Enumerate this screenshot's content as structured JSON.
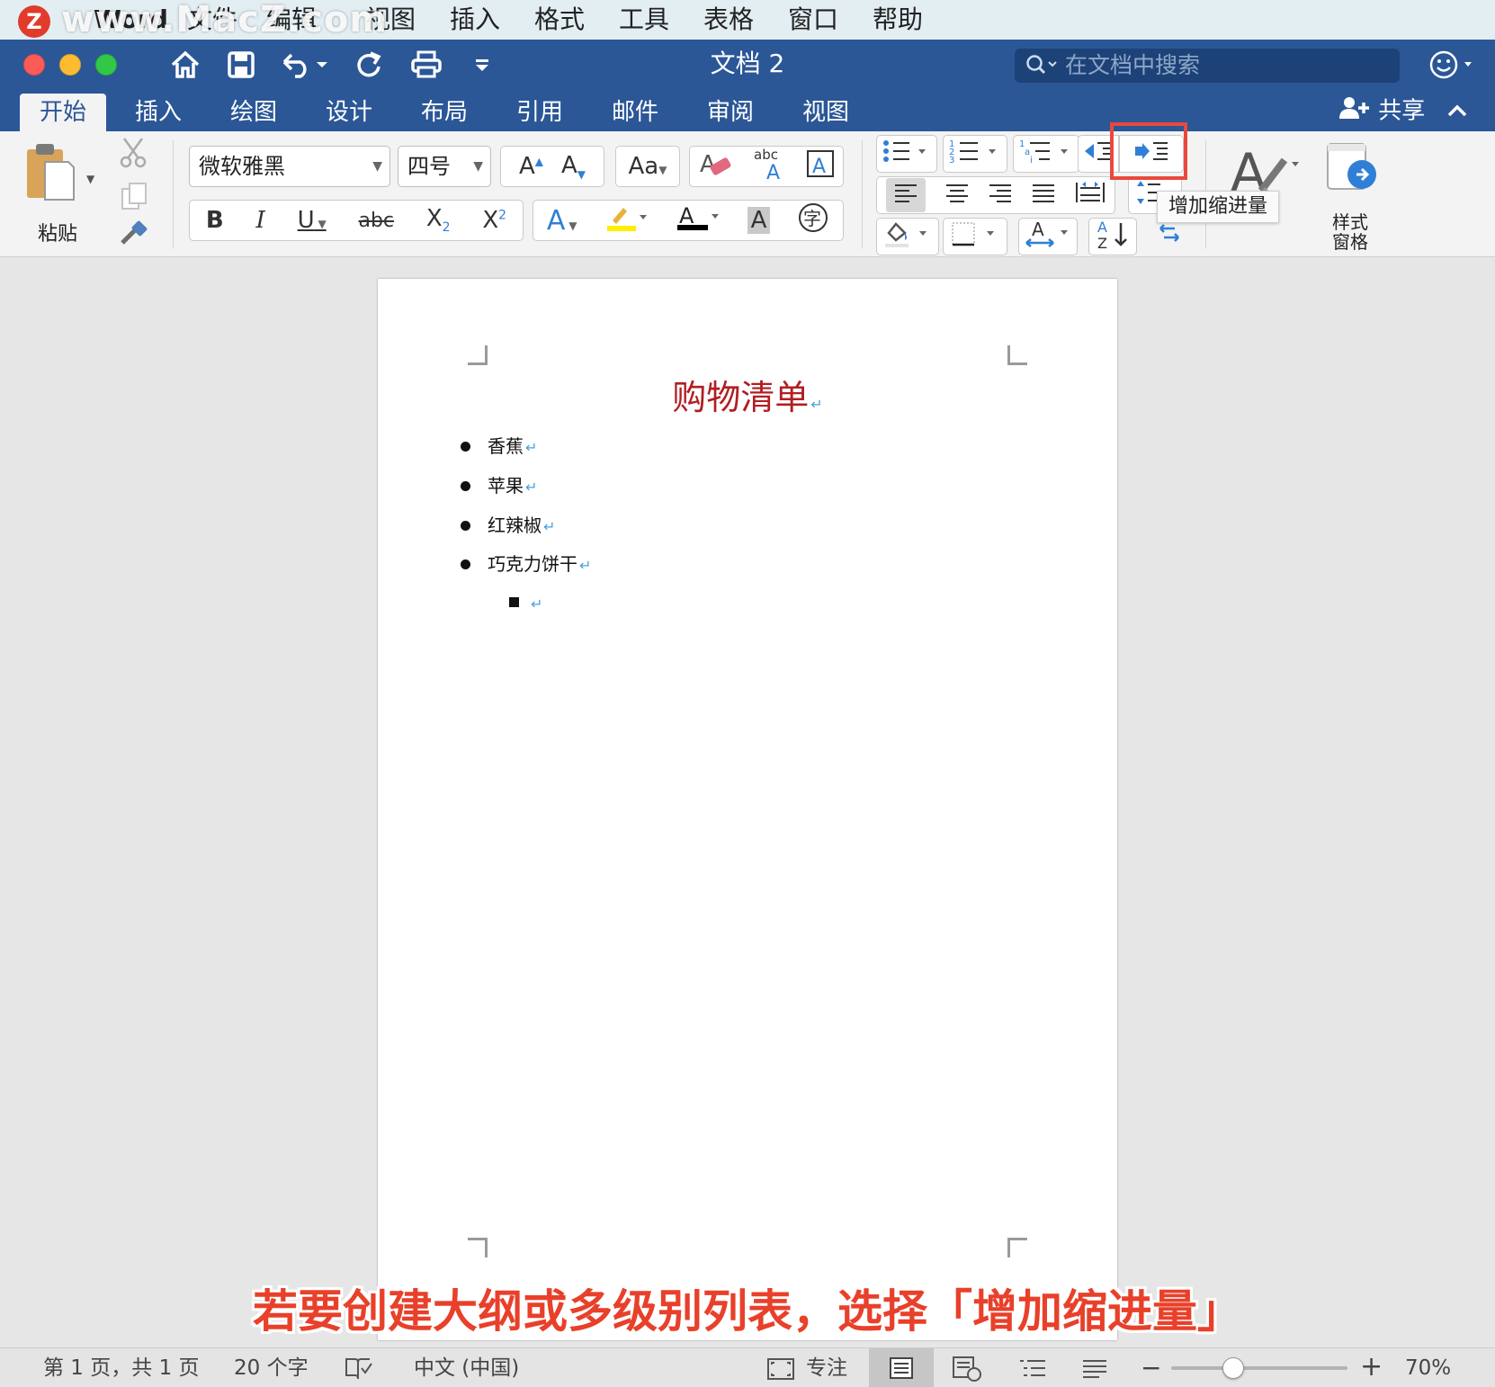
{
  "watermark": "www.MacZ.com",
  "menubar": {
    "app_name": "Word",
    "items": [
      "文件",
      "编辑",
      "视图",
      "插入",
      "格式",
      "工具",
      "表格",
      "窗口",
      "帮助"
    ]
  },
  "titlebar": {
    "title": "文档 2",
    "search_placeholder": "在文档中搜索"
  },
  "ribbon_tabs": {
    "tabs": [
      "开始",
      "插入",
      "绘图",
      "设计",
      "布局",
      "引用",
      "邮件",
      "审阅",
      "视图"
    ],
    "active": "开始",
    "share_label": "共享"
  },
  "ribbon": {
    "paste_label": "粘贴",
    "font_name": "微软雅黑",
    "font_size": "四号",
    "styles_pane_label": "样式窗格",
    "tooltip": "增加缩进量"
  },
  "document": {
    "heading": "购物清单",
    "items": [
      "香蕉",
      "苹果",
      "红辣椒",
      "巧克力饼干"
    ],
    "paragraph_mark": "↵"
  },
  "caption": "若要创建大纲或多级别列表，选择「增加缩进量」",
  "statusbar": {
    "page_info": "第 1 页，共 1 页",
    "word_count": "20 个字",
    "language": "中文 (中国)",
    "focus_label": "专注",
    "zoom": "70%",
    "zoom_fraction": 0.35
  },
  "colors": {
    "accent": "#2b5797",
    "heading": "#b01e22",
    "caption": "#e8402a",
    "highlight_box": "#e8493c"
  }
}
